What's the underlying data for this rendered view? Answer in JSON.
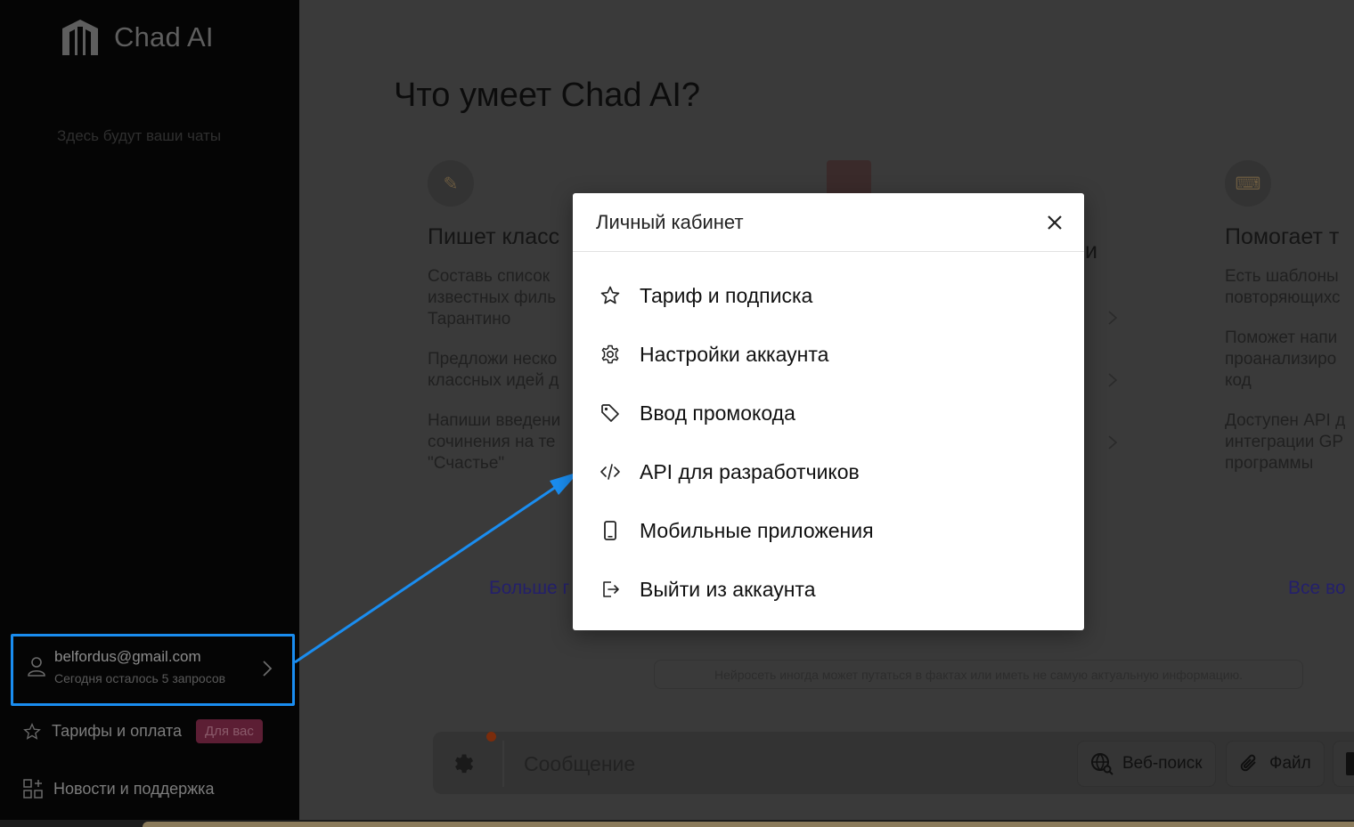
{
  "sidebar": {
    "app_name": "Chad AI",
    "empty_chats": "Здесь будут ваши чаты",
    "account": {
      "email": "belfordus@gmail.com",
      "requests_left": "Сегодня осталось 5 запросов"
    },
    "nav": {
      "tariffs_label": "Тарифы и оплата",
      "tariffs_badge": "Для вас",
      "news_label": "Новости и поддержка"
    }
  },
  "main": {
    "title": "Что умеет Chad AI?",
    "cards": [
      {
        "icon": "pencil-icon",
        "title": "Пишет класс",
        "lines": [
          "Составь список",
          "известных филь",
          "Тарантино",
          "",
          "Предложи неско",
          "классных идей д",
          "",
          "Напиши введени",
          "сочинения на те",
          "\"Счастье\""
        ],
        "more": "Больше г"
      },
      {
        "icon": "image-icon",
        "title": "и"
      },
      {
        "icon": "keyboard-icon",
        "title": "Помогает т",
        "lines": [
          "Есть шаблоны",
          "повторяющихс",
          "",
          "Поможет напи",
          "проанализиро",
          "код",
          "",
          "Доступен API д",
          "интеграции GP",
          "программы"
        ],
        "more": "Все во"
      }
    ],
    "disclaimer": "Нейросеть иногда может путаться в фактах или иметь не самую актуальную информацию.",
    "composer": {
      "placeholder": "Сообщение",
      "web_search_label": "Веб-поиск",
      "file_label": "Файл"
    }
  },
  "modal": {
    "title": "Личный кабинет",
    "items": [
      {
        "label": "Тариф и подписка",
        "icon": "star-icon"
      },
      {
        "label": "Настройки аккаунта",
        "icon": "gear-icon"
      },
      {
        "label": "Ввод промокода",
        "icon": "tag-icon"
      },
      {
        "label": "API для разработчиков",
        "icon": "code-icon"
      },
      {
        "label": "Мобильные приложения",
        "icon": "mobile-icon"
      },
      {
        "label": "Выйти из аккаунта",
        "icon": "logout-icon"
      }
    ]
  },
  "colors": {
    "highlight": "#1a8df0",
    "sidebar_bg": "#050505",
    "overlay_bg": "#3a3a3a",
    "modal_bg": "#ffffff"
  }
}
